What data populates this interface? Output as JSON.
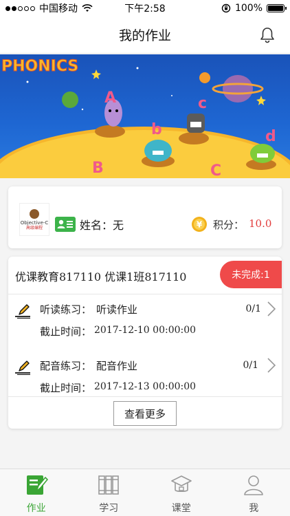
{
  "status_bar": {
    "carrier": "中国移动",
    "time": "下午2:58",
    "battery": "100%"
  },
  "nav": {
    "title": "我的作业"
  },
  "profile": {
    "book_title": "Objective-C",
    "book_subtitle": "高级编程",
    "name_label": "姓名：",
    "name_value": "无",
    "points_label": "积分：",
    "points_value": "10.0"
  },
  "homework": {
    "class_name": "优课教育817110 优课1班817110",
    "status_badge": "未完成:1",
    "tasks": [
      {
        "type": "听读练习：",
        "name": "听读作业",
        "deadline_label": "截止时间：",
        "deadline": "2017-12-10 00:00:00",
        "progress": "0/1"
      },
      {
        "type": "配音练习：",
        "name": "配音作业",
        "deadline_label": "截止时间：",
        "deadline": "2017-12-13 00:00:00",
        "progress": "0/1"
      }
    ],
    "more_label": "查看更多"
  },
  "tabbar": {
    "tabs": [
      {
        "label": "作业",
        "icon": "homework-icon",
        "active": true
      },
      {
        "label": "学习",
        "icon": "books-icon",
        "active": false
      },
      {
        "label": "课堂",
        "icon": "classroom-icon",
        "active": false
      },
      {
        "label": "我",
        "icon": "person-icon",
        "active": false
      }
    ]
  },
  "colors": {
    "accent_green": "#3aa535",
    "status_red": "#ef4a4a",
    "points_red": "#e23c3c"
  }
}
